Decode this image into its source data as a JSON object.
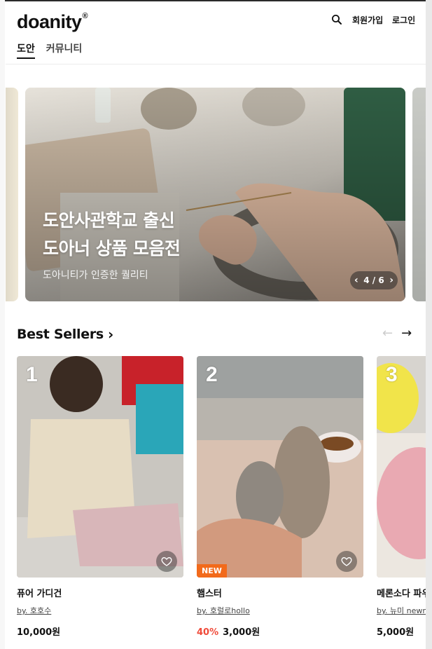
{
  "header": {
    "logo": "doanity",
    "logo_mark": "®",
    "signup": "회원가입",
    "login": "로그인",
    "tabs": [
      {
        "label": "도안",
        "active": true
      },
      {
        "label": "커뮤니티",
        "active": false
      }
    ]
  },
  "banner": {
    "title": "도안사관학교 출신\n도아너 상품 모음전",
    "subtitle": "도아니티가 인증한 퀄리티",
    "pager": "4 / 6"
  },
  "best_sellers": {
    "title": "Best Sellers",
    "products": [
      {
        "rank": "1",
        "name": "퓨어 가디건",
        "seller": "by. 호호수",
        "discount": "",
        "price": "10,000원",
        "badge": ""
      },
      {
        "rank": "2",
        "name": "햄스터",
        "seller": "by. 호럴로hollo",
        "discount": "40%",
        "price": "3,000원",
        "badge": "NEW"
      },
      {
        "rank": "3",
        "name": "메론소다 파우치",
        "seller": "by. 뉴미 newmi",
        "discount": "",
        "price": "5,000원",
        "badge": ""
      }
    ]
  },
  "colors": {
    "accent_discount": "#f04b3a",
    "badge_new": "#f26a1b"
  }
}
